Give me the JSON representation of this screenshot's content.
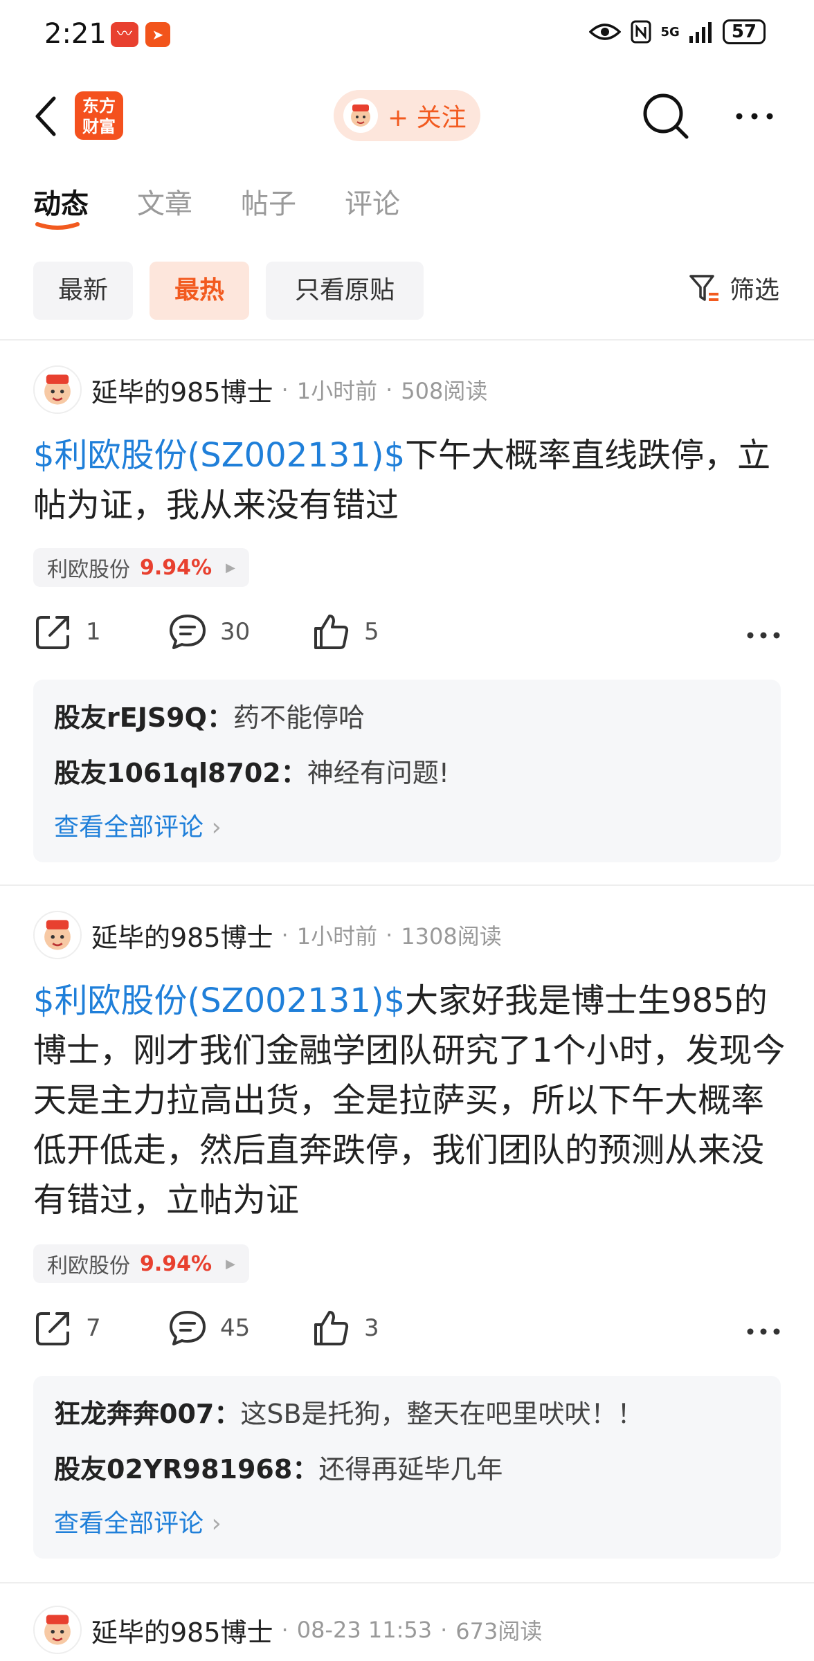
{
  "status_bar": {
    "time": "2:21",
    "battery": "57",
    "network": "5G",
    "icons": [
      "eye-icon",
      "nfc-icon",
      "signal-icon"
    ]
  },
  "header": {
    "logo_line1": "东方",
    "logo_line2": "财富",
    "follow_label": "+ 关注"
  },
  "tabs": [
    "动态",
    "文章",
    "帖子",
    "评论"
  ],
  "filters": {
    "chips": [
      "最新",
      "最热",
      "只看原贴"
    ],
    "filter_label": "筛选"
  },
  "colors": {
    "accent": "#f25a1f",
    "link": "#1f7fd9",
    "up": "#e8402f"
  },
  "posts": [
    {
      "author": "延毕的985博士",
      "time": "1小时前",
      "reads": "508阅读",
      "tag": "$利欧股份(SZ002131)$",
      "text": "下午大概率直线跌停，立帖为证，我从来没有错过",
      "stock_name": "利欧股份",
      "stock_pct": "9.94%",
      "shares": "1",
      "comments_count": "30",
      "likes": "5",
      "comments": [
        {
          "user": "股友rEJS9Q",
          "text": "药不能停哈"
        },
        {
          "user": "股友1061ql8702",
          "text": "神经有问题!"
        }
      ],
      "view_all": "查看全部评论"
    },
    {
      "author": "延毕的985博士",
      "time": "1小时前",
      "reads": "1308阅读",
      "tag": "$利欧股份(SZ002131)$",
      "text": "大家好我是博士生985的博士，刚才我们金融学团队研究了1个小时，发现今天是主力拉高出货，全是拉萨买，所以下午大概率低开低走，然后直奔跌停，我们团队的预测从来没有错过，立帖为证",
      "stock_name": "利欧股份",
      "stock_pct": "9.94%",
      "shares": "7",
      "comments_count": "45",
      "likes": "3",
      "comments": [
        {
          "user": "狂龙奔奔007",
          "text": "这SB是托狗，整天在吧里吠吠！！"
        },
        {
          "user": "股友02YR981968",
          "text": "还得再延毕几年"
        }
      ],
      "view_all": "查看全部评论"
    },
    {
      "author": "延毕的985博士",
      "time": "08-23 11:53",
      "reads": "673阅读"
    }
  ],
  "separator": "·",
  "colon": "：",
  "chevron": "›"
}
